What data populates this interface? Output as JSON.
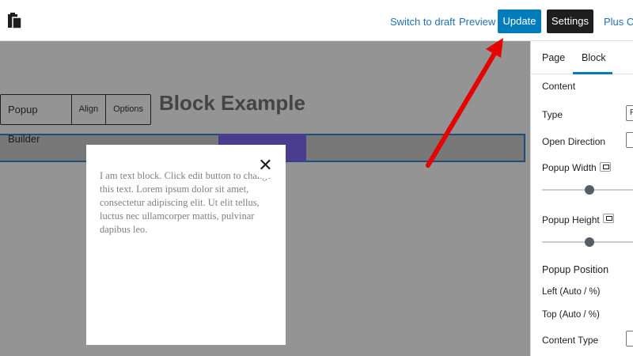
{
  "header": {
    "links": [
      "Switch to draft",
      "Preview"
    ],
    "update_label": "Update",
    "settings_label": "Settings",
    "plus_label": "Plus Cus"
  },
  "canvas": {
    "toolbar": [
      "Popup Builder",
      "Align",
      "Options"
    ],
    "heading": "Block Example"
  },
  "popup": {
    "text": "I am text block. Click edit button to change this text. Lorem ipsum dolor sit amet, consectetur adipiscing elit. Ut elit tellus, luctus nec ullamcorper mattis, pulvinar dapibus leo.",
    "close_icon": "close-icon"
  },
  "sidebar": {
    "tabs": [
      "Page",
      "Block"
    ],
    "active_tab": "Block",
    "section": "Content",
    "type_label": "Type",
    "type_value_fragment": "F",
    "open_direction_label": "Open Direction",
    "popup_width_label": "Popup Width",
    "popup_height_label": "Popup Height",
    "popup_position_label": "Popup Position",
    "left_label": "Left (Auto / %)",
    "top_label": "Top (Auto / %)",
    "content_type_label": "Content Type"
  },
  "colors": {
    "accent": "#007cba",
    "arrow": "#e60000",
    "overlay": "#949494"
  }
}
